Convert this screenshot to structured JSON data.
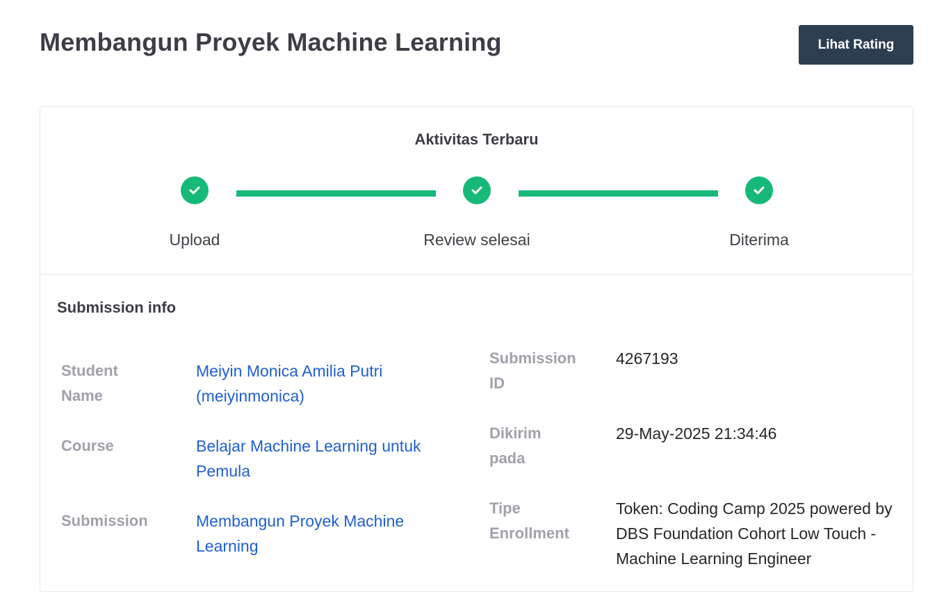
{
  "header": {
    "title": "Membangun Proyek Machine Learning",
    "rating_button": "Lihat Rating"
  },
  "activity": {
    "title": "Aktivitas Terbaru",
    "steps": [
      {
        "label": "Upload",
        "status": "done"
      },
      {
        "label": "Review selesai",
        "status": "done"
      },
      {
        "label": "Diterima",
        "status": "done"
      }
    ],
    "accent_color": "#17b978"
  },
  "submission_info": {
    "title": "Submission info",
    "student_name": {
      "label": "Student Name",
      "value": "Meiyin Monica Amilia Putri (meiyinmonica)"
    },
    "course": {
      "label": "Course",
      "value": "Belajar Machine Learning untuk Pemula"
    },
    "submission": {
      "label": "Submission",
      "value": "Membangun Proyek Machine Learning"
    },
    "submission_id": {
      "label": "Submission ID",
      "value": "4267193"
    },
    "sent_at": {
      "label": "Dikirim pada",
      "value": "29-May-2025 21:34:46"
    },
    "enrollment_type": {
      "label": "Tipe Enrollment",
      "value": "Token: Coding Camp 2025 powered by DBS Foundation Cohort Low Touch - Machine Learning Engineer"
    }
  }
}
